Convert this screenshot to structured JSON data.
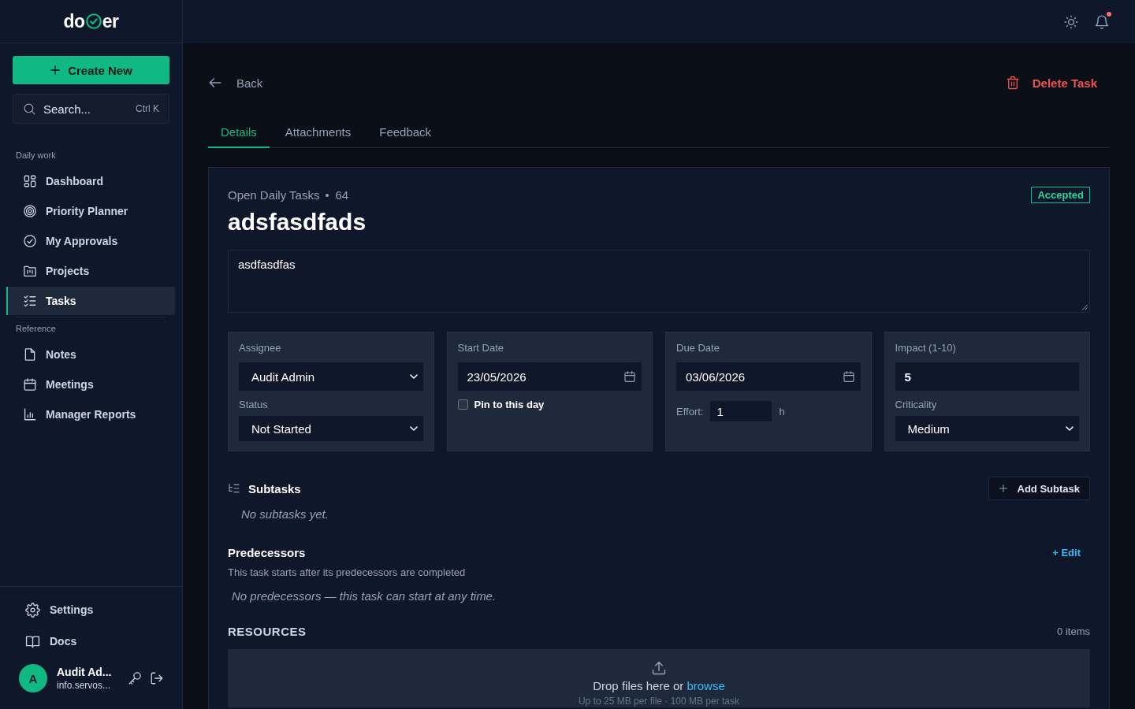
{
  "sidebar": {
    "logo": {
      "start": "do",
      "end": "er"
    },
    "create_button": "Create New",
    "search": {
      "placeholder": "Search...",
      "shortcut": "Ctrl K"
    },
    "sections": [
      {
        "title": "Daily work",
        "items": [
          {
            "label": "Dashboard",
            "selected": false
          },
          {
            "label": "Priority Planner",
            "selected": false
          },
          {
            "label": "My Approvals",
            "selected": false
          },
          {
            "label": "Projects",
            "selected": false
          },
          {
            "label": "Tasks",
            "selected": true
          }
        ]
      },
      {
        "title": "Reference",
        "items": [
          {
            "label": "Notes",
            "selected": false
          },
          {
            "label": "Meetings",
            "selected": false
          },
          {
            "label": "Manager Reports",
            "selected": false
          }
        ]
      }
    ],
    "footer_items": [
      {
        "label": "Settings"
      },
      {
        "label": "Docs"
      }
    ],
    "user": {
      "initial": "A",
      "name": "Audit Ad...",
      "email": "info.servos..."
    }
  },
  "top_bar": {
    "notifications_unread": true
  },
  "page": {
    "back": "Back",
    "delete_button": "Delete Task",
    "tabs": [
      {
        "label": "Details",
        "selected": true
      },
      {
        "label": "Attachments",
        "selected": false
      },
      {
        "label": "Feedback",
        "selected": false
      }
    ]
  },
  "task": {
    "list": "Open Daily Tasks",
    "number": "64",
    "status_badge": "Accepted",
    "title": "adsfasdfads",
    "description": "asdfasdfas"
  },
  "panels": [
    {
      "fields": [
        {
          "kind": "select",
          "label": "Assignee",
          "value": "Audit Admin"
        },
        {
          "kind": "select",
          "label": "Status",
          "value": "Not Started"
        }
      ]
    },
    {
      "fields": [
        {
          "kind": "date",
          "label": "Start Date",
          "value": "23/05/2026"
        },
        {
          "kind": "checkbox",
          "label": "Pin to this day",
          "checked": false
        }
      ]
    },
    {
      "fields": [
        {
          "kind": "date",
          "label": "Due Date",
          "value": "03/06/2026"
        },
        {
          "kind": "inline-number",
          "label": "Effort:",
          "value": "1",
          "unit": "h"
        }
      ]
    },
    {
      "fields": [
        {
          "kind": "number",
          "label": "Impact (1-10)",
          "value": "5"
        },
        {
          "kind": "select",
          "label": "Criticality",
          "value": "Medium"
        }
      ]
    }
  ],
  "subtasks": {
    "title": "Subtasks",
    "add_button": "Add Subtask",
    "empty_text": "No subtasks yet."
  },
  "predecessors": {
    "title": "Predecessors",
    "edit_link": "+ Edit",
    "description": "This task starts after its predecessors are completed",
    "empty_text": "No predecessors — this task can start at any time."
  },
  "resources": {
    "title": "RESOURCES",
    "count": "0 items",
    "drop_text": "Drop files here or",
    "browse_link": "browse",
    "hint": "Up to 25 MB per file · 100 MB per task"
  }
}
